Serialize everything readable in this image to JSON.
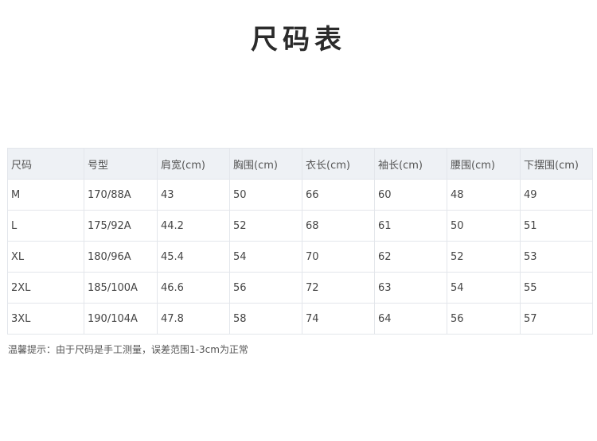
{
  "title": "尺码表",
  "table": {
    "headers": [
      "尺码",
      "号型",
      "肩宽(cm)",
      "胸围(cm)",
      "衣长(cm)",
      "袖长(cm)",
      "腰围(cm)",
      "下摆围(cm)"
    ],
    "rows": [
      [
        "M",
        "170/88A",
        "43",
        "50",
        "66",
        "60",
        "48",
        "49"
      ],
      [
        "L",
        "175/92A",
        "44.2",
        "52",
        "68",
        "61",
        "50",
        "51"
      ],
      [
        "XL",
        "180/96A",
        "45.4",
        "54",
        "70",
        "62",
        "52",
        "53"
      ],
      [
        "2XL",
        "185/100A",
        "46.6",
        "56",
        "72",
        "63",
        "54",
        "55"
      ],
      [
        "3XL",
        "190/104A",
        "47.8",
        "58",
        "74",
        "64",
        "56",
        "57"
      ]
    ]
  },
  "note": "温馨提示：由于尺码是手工测量，误差范围1-3cm为正常"
}
